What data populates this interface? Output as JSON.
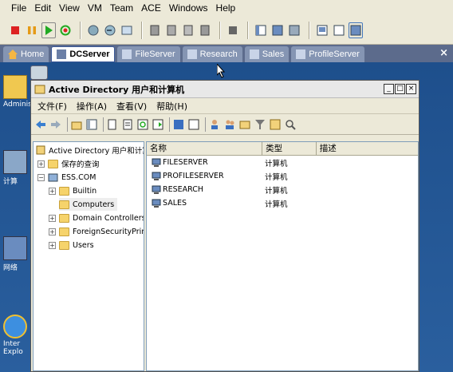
{
  "vmware": {
    "menu": [
      "File",
      "Edit",
      "View",
      "VM",
      "Team",
      "ACE",
      "Windows",
      "Help"
    ],
    "tabs": [
      {
        "label": "Home",
        "active": false
      },
      {
        "label": "DCServer",
        "active": true
      },
      {
        "label": "FileServer",
        "active": false
      },
      {
        "label": "Research",
        "active": false
      },
      {
        "label": "Sales",
        "active": false
      },
      {
        "label": "ProfileServer",
        "active": false
      }
    ],
    "tabs_close": "×"
  },
  "desktop": {
    "icons": [
      {
        "label": "Adminis"
      },
      {
        "label": ""
      },
      {
        "label": "计算"
      },
      {
        "label": "网络"
      },
      {
        "label": "Inter\nExplo"
      }
    ]
  },
  "aduc": {
    "title": "Active Directory 用户和计算机",
    "window_buttons": [
      "_",
      "□",
      "×"
    ],
    "menu": [
      "文件(F)",
      "操作(A)",
      "查看(V)",
      "帮助(H)"
    ],
    "tree": {
      "root": "Active Directory 用户和计算机",
      "items": [
        {
          "label": "保存的查询",
          "expander": "+",
          "level": 1
        },
        {
          "label": "ESS.COM",
          "expander": "−",
          "level": 1
        },
        {
          "label": "Builtin",
          "expander": "+",
          "level": 2
        },
        {
          "label": "Computers",
          "expander": "",
          "level": 2,
          "selected": true
        },
        {
          "label": "Domain Controllers",
          "expander": "+",
          "level": 2
        },
        {
          "label": "ForeignSecurityPrincip",
          "expander": "+",
          "level": 2
        },
        {
          "label": "Users",
          "expander": "+",
          "level": 2
        }
      ]
    },
    "list": {
      "columns": [
        "名称",
        "类型",
        "描述"
      ],
      "rows": [
        {
          "name": "FILESERVER",
          "type": "计算机"
        },
        {
          "name": "PROFILESERVER",
          "type": "计算机"
        },
        {
          "name": "RESEARCH",
          "type": "计算机"
        },
        {
          "name": "SALES",
          "type": "计算机"
        }
      ]
    }
  }
}
